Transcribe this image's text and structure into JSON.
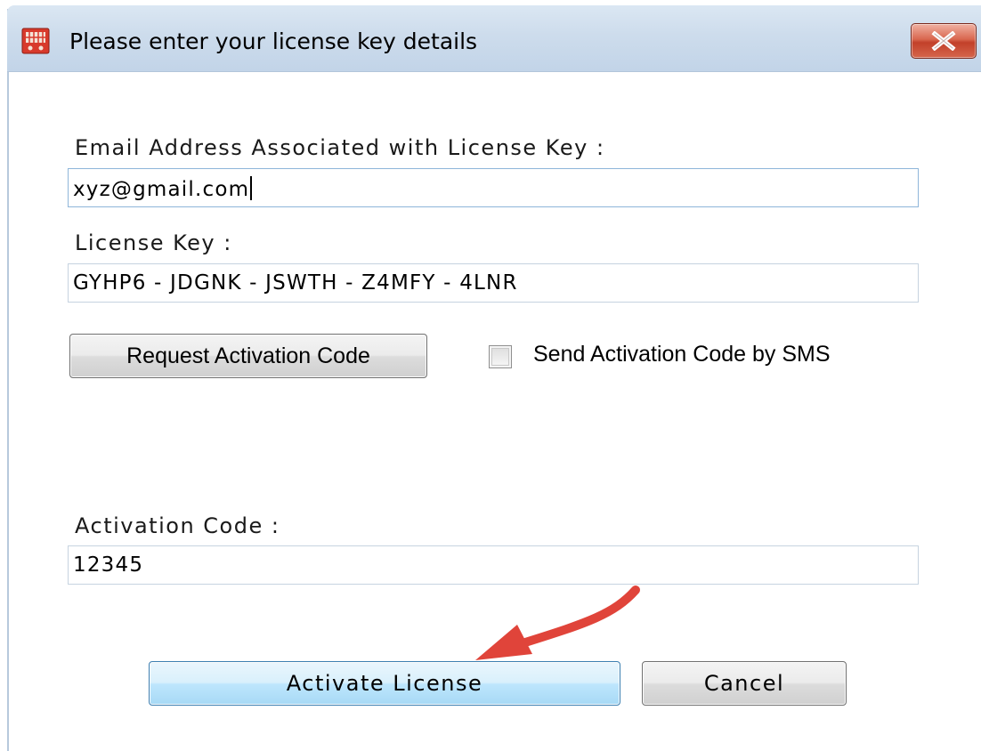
{
  "window": {
    "title": "Please enter your license key details",
    "icon": "shopping-cart-icon",
    "close": "close-icon"
  },
  "form": {
    "email_label": "Email Address Associated with License Key :",
    "email_value": "xyz@gmail.com",
    "license_label": "License Key :",
    "license_value": "GYHP6 - JDGNK - JSWTH - Z4MFY - 4LNR",
    "request_button": "Request Activation Code",
    "sms_checkbox_label": "Send Activation Code by SMS",
    "sms_checked": false,
    "activation_label": "Activation Code  :",
    "activation_value": "12345"
  },
  "footer": {
    "activate_button": "Activate License",
    "cancel_button": "Cancel"
  },
  "annotation": {
    "arrow_color": "#e0443a",
    "target": "activate-license-button"
  },
  "colors": {
    "titlebar": "#cddcec",
    "close_button": "#c2402a",
    "default_button_border": "#3c7fb1"
  }
}
